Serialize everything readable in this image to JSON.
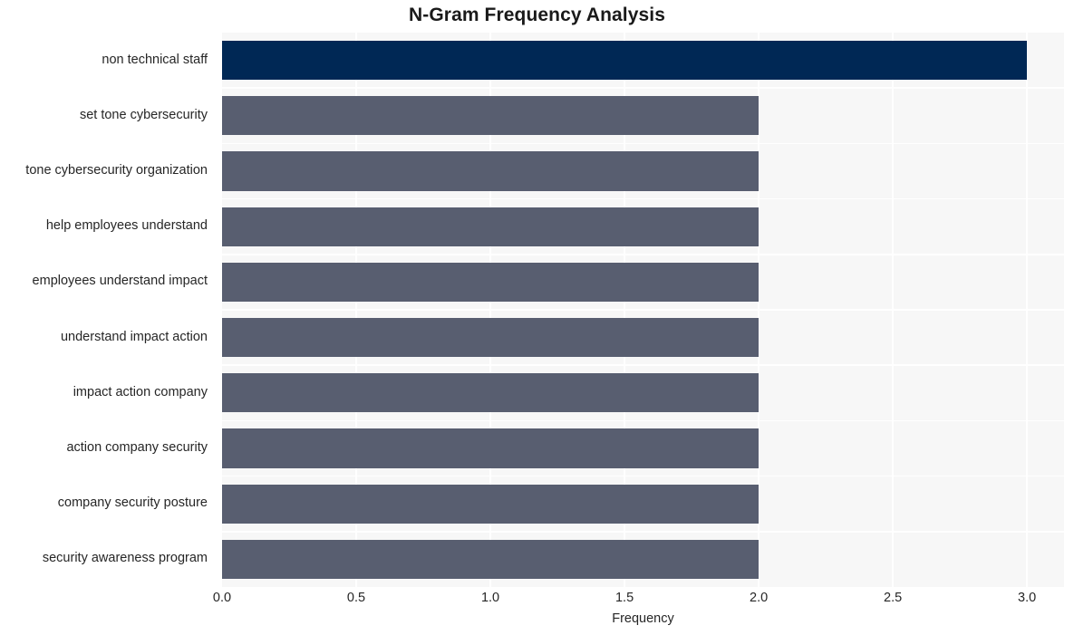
{
  "chart_data": {
    "type": "bar",
    "orientation": "horizontal",
    "title": "N-Gram Frequency Analysis",
    "xlabel": "Frequency",
    "ylabel": "",
    "categories": [
      "non technical staff",
      "set tone cybersecurity",
      "tone cybersecurity organization",
      "help employees understand",
      "employees understand impact",
      "understand impact action",
      "impact action company",
      "action company security",
      "company security posture",
      "security awareness program"
    ],
    "values": [
      3,
      2,
      2,
      2,
      2,
      2,
      2,
      2,
      2,
      2
    ],
    "bar_colors": [
      "#002855",
      "#585e70",
      "#585e70",
      "#585e70",
      "#585e70",
      "#585e70",
      "#585e70",
      "#585e70",
      "#585e70",
      "#585e70"
    ],
    "xlim": [
      0,
      3.138
    ],
    "xticks": [
      0,
      0.5,
      1,
      1.5,
      2,
      2.5,
      3
    ],
    "xtick_labels": [
      "0.0",
      "0.5",
      "1.0",
      "1.5",
      "2.0",
      "2.5",
      "3.0"
    ],
    "grid": true,
    "grid_color": "#ffffff",
    "plot_background": "#f7f7f7",
    "figure_background": "#ffffff",
    "legend": null,
    "legend_position": "none",
    "highlight_color": "#002855",
    "base_color": "#585e70",
    "text_color": "#262626"
  }
}
